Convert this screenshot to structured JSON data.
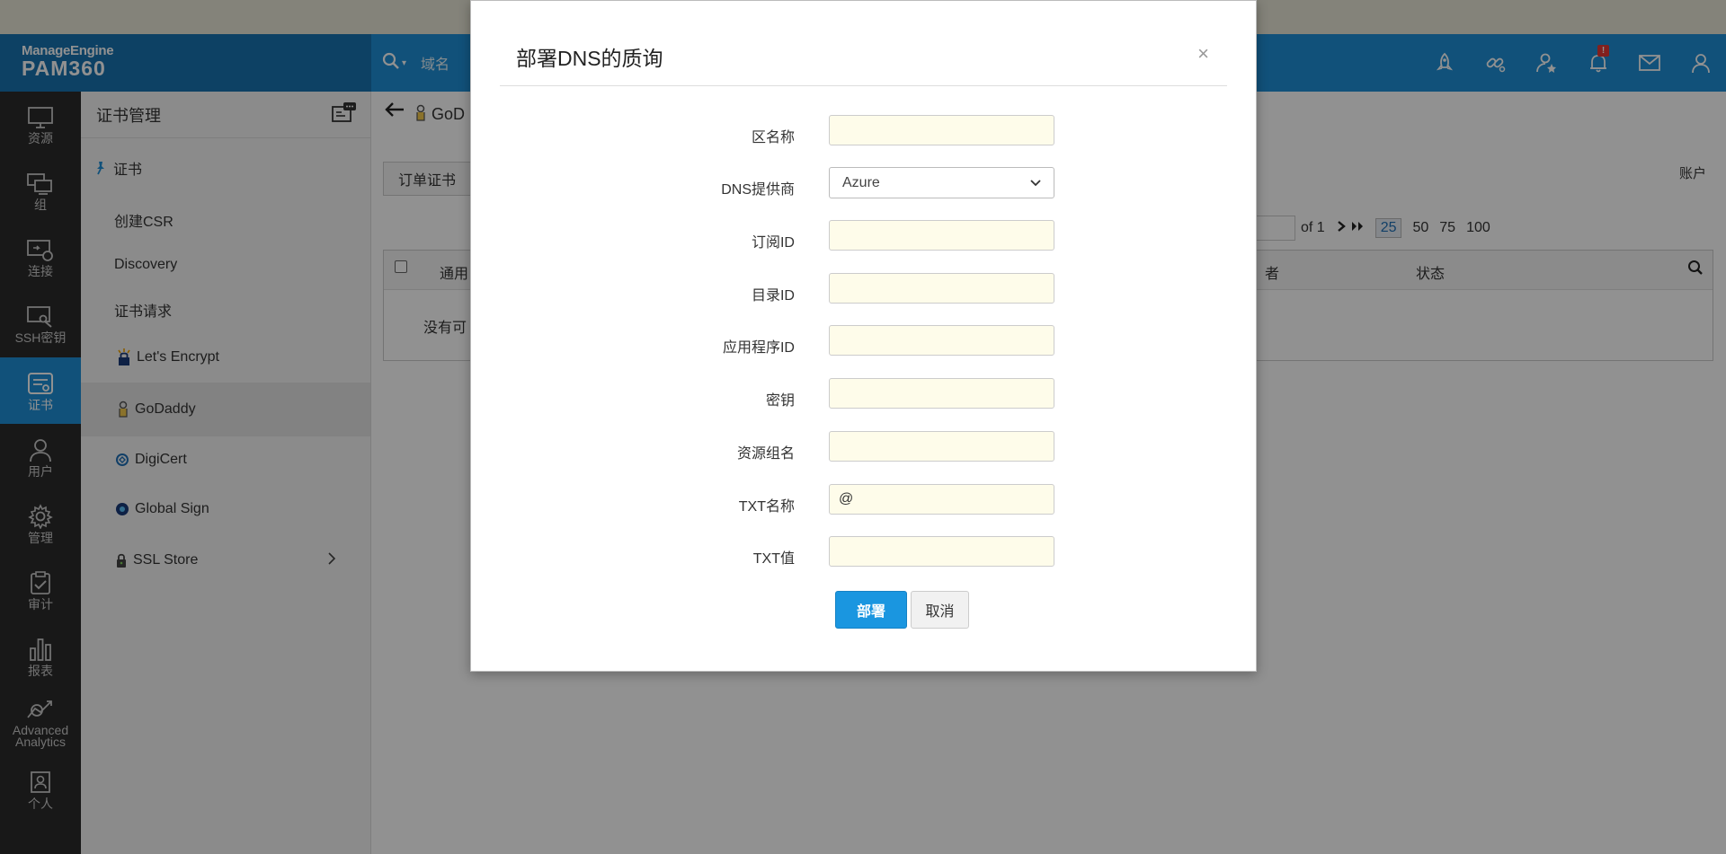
{
  "app": {
    "brand_top": "ManageEngine",
    "brand_bottom": "PAM360",
    "search_placeholder": "域名"
  },
  "header_icons": [
    "rocket-icon",
    "link-key-icon",
    "user-star-icon",
    "bell-icon",
    "mail-icon",
    "user-icon"
  ],
  "notification_badge": "!",
  "left_nav": [
    {
      "label": "资源",
      "icon": "monitor-icon"
    },
    {
      "label": "组",
      "icon": "group-icon"
    },
    {
      "label": "连接",
      "icon": "connection-icon"
    },
    {
      "label": "SSH密钥",
      "icon": "ssh-key-icon"
    },
    {
      "label": "证书",
      "icon": "certificate-icon",
      "active": true
    },
    {
      "label": "用户",
      "icon": "user-icon"
    },
    {
      "label": "管理",
      "icon": "gear-icon"
    },
    {
      "label": "审计",
      "icon": "clipboard-check-icon"
    },
    {
      "label": "报表",
      "icon": "bar-chart-icon"
    },
    {
      "label": "Advanced Analytics",
      "icon": "analytics-icon"
    },
    {
      "label": "个人",
      "icon": "personal-icon"
    }
  ],
  "subnav": {
    "title": "证书管理",
    "items": [
      {
        "label": "证书"
      },
      {
        "label": "创建CSR"
      },
      {
        "label": "Discovery"
      },
      {
        "label": "证书请求"
      },
      {
        "label": "Let's Encrypt"
      },
      {
        "label": "GoDaddy",
        "active": true
      },
      {
        "label": "DigiCert"
      },
      {
        "label": "Global Sign"
      },
      {
        "label": "SSL Store"
      }
    ]
  },
  "main": {
    "breadcrumb": "GoD",
    "order_button": "订单证书",
    "account_label": "账户",
    "pager": {
      "of_label": "of 1",
      "page_sizes": [
        "25",
        "50",
        "75",
        "100"
      ],
      "selected_size": "25"
    },
    "grid": {
      "col_common": "通用",
      "col_partial": "者",
      "col_status": "状态",
      "empty_text": "没有可"
    }
  },
  "modal": {
    "title": "部署DNS的质询",
    "close": "×",
    "fields": [
      {
        "label": "区名称",
        "value": ""
      },
      {
        "label": "DNS提供商",
        "value": "Azure",
        "type": "select"
      },
      {
        "label": "订阅ID",
        "value": ""
      },
      {
        "label": "目录ID",
        "value": ""
      },
      {
        "label": "应用程序ID",
        "value": ""
      },
      {
        "label": "密钥",
        "value": ""
      },
      {
        "label": "资源组名",
        "value": ""
      },
      {
        "label": "TXT名称",
        "value": "@"
      },
      {
        "label": "TXT值",
        "value": ""
      }
    ],
    "deploy_button": "部署",
    "cancel_button": "取消"
  },
  "colors": {
    "header": "#1f8fd6",
    "logo_bg": "#1872b0",
    "nav_bg": "#2b2b2b",
    "primary_button": "#1a96e0",
    "input_bg": "#fefcea"
  }
}
